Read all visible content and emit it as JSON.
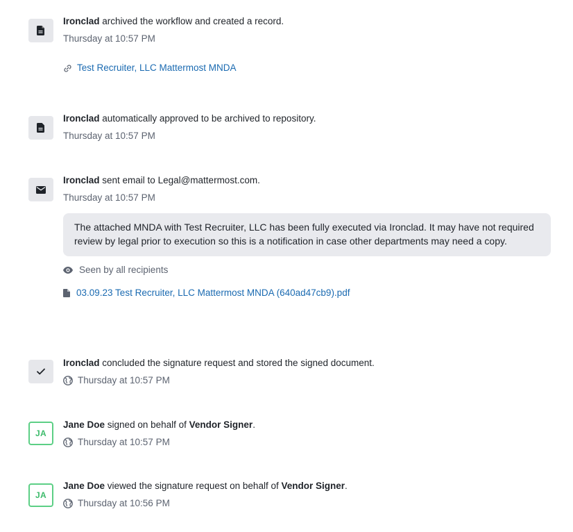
{
  "events": [
    {
      "actor": "Ironclad",
      "action": "archived the workflow and created a record.",
      "time": "Thursday at 10:57 PM",
      "icon": "document-icon",
      "link": {
        "icon": "link-icon",
        "label": "Test Recruiter, LLC Mattermost MNDA"
      }
    },
    {
      "actor": "Ironclad",
      "action": "automatically approved to be archived to repository.",
      "time": "Thursday at 10:57 PM",
      "icon": "document-icon"
    },
    {
      "actor": "Ironclad",
      "action": "sent email to Legal@mattermost.com.",
      "time": "Thursday at 10:57 PM",
      "icon": "envelope-icon",
      "email_body": "The attached MNDA with Test Recruiter, LLC has been fully executed via Ironclad. It may have not required review by legal prior to execution so this is a notification in case other departments may need a copy.",
      "seen_label": "Seen by all recipients",
      "attachment": {
        "icon": "file-icon",
        "label": "03.09.23 Test Recruiter, LLC Mattermost MNDA (640ad47cb9).pdf"
      }
    },
    {
      "actor": "Ironclad",
      "action": "concluded the signature request and stored the signed document.",
      "time": "Thursday at 10:57 PM",
      "icon": "checkmark-icon"
    },
    {
      "actor": "Jane Doe",
      "action": "signed on behalf of",
      "role": "Vendor Signer",
      "suffix": ".",
      "time": "Thursday at 10:57 PM",
      "initials": "JA"
    },
    {
      "actor": "Jane Doe",
      "action": "viewed the signature request on behalf of",
      "role": "Vendor Signer",
      "suffix": ".",
      "time": "Thursday at 10:56 PM",
      "initials": "JA"
    }
  ],
  "colors": {
    "link": "#1a6ab1",
    "avatar_bg": "#e6e7eb",
    "initials_green": "#3dbb6b",
    "email_bg": "#e9eaee",
    "muted_text": "#5c6370"
  }
}
